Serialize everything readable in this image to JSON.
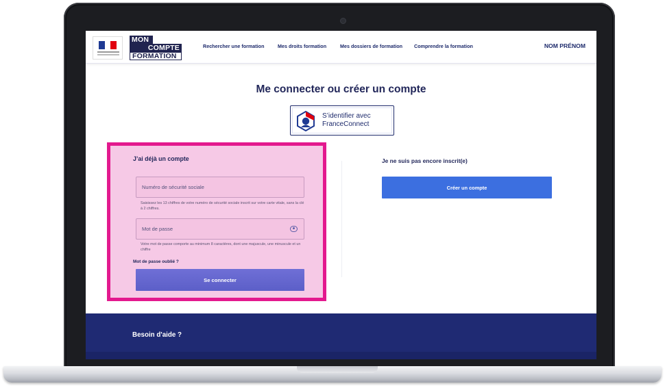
{
  "header": {
    "brand": {
      "line1": "MON",
      "line2": "COMPTE",
      "line3": "FORMATION"
    },
    "nav": [
      "Rechercher une formation",
      "Mes droits formation",
      "Mes dossiers de formation",
      "Comprendre la formation"
    ],
    "user": "NOM PRÉNOM"
  },
  "main": {
    "title": "Me connecter ou créer un compte",
    "franceconnect": {
      "line1": "S’identifier avec",
      "line2": "FranceConnect"
    }
  },
  "login": {
    "title": "J’ai déjà un compte",
    "ssn_placeholder": "Numéro de sécurité sociale",
    "ssn_hint": "Saisissez les 13 chiffres de votre numéro de sécurité sociale inscrit sur votre carte vitale, sans la clé à 2 chiffres.",
    "password_placeholder": "Mot de passe",
    "password_hint": "Votre mot de passe comporte au minimum 8 caractères, dont une majuscule, une minuscule et un chiffre",
    "forgot": "Mot de passe oublié ?",
    "submit": "Se connecter"
  },
  "register": {
    "title": "Je ne suis pas encore inscrit(e)",
    "button": "Créer un compte"
  },
  "footer": {
    "title": "Besoin d'aide ?"
  },
  "colors": {
    "highlight": "#e3198e",
    "navy": "#1f2a73",
    "primary": "#3c6fe0"
  }
}
